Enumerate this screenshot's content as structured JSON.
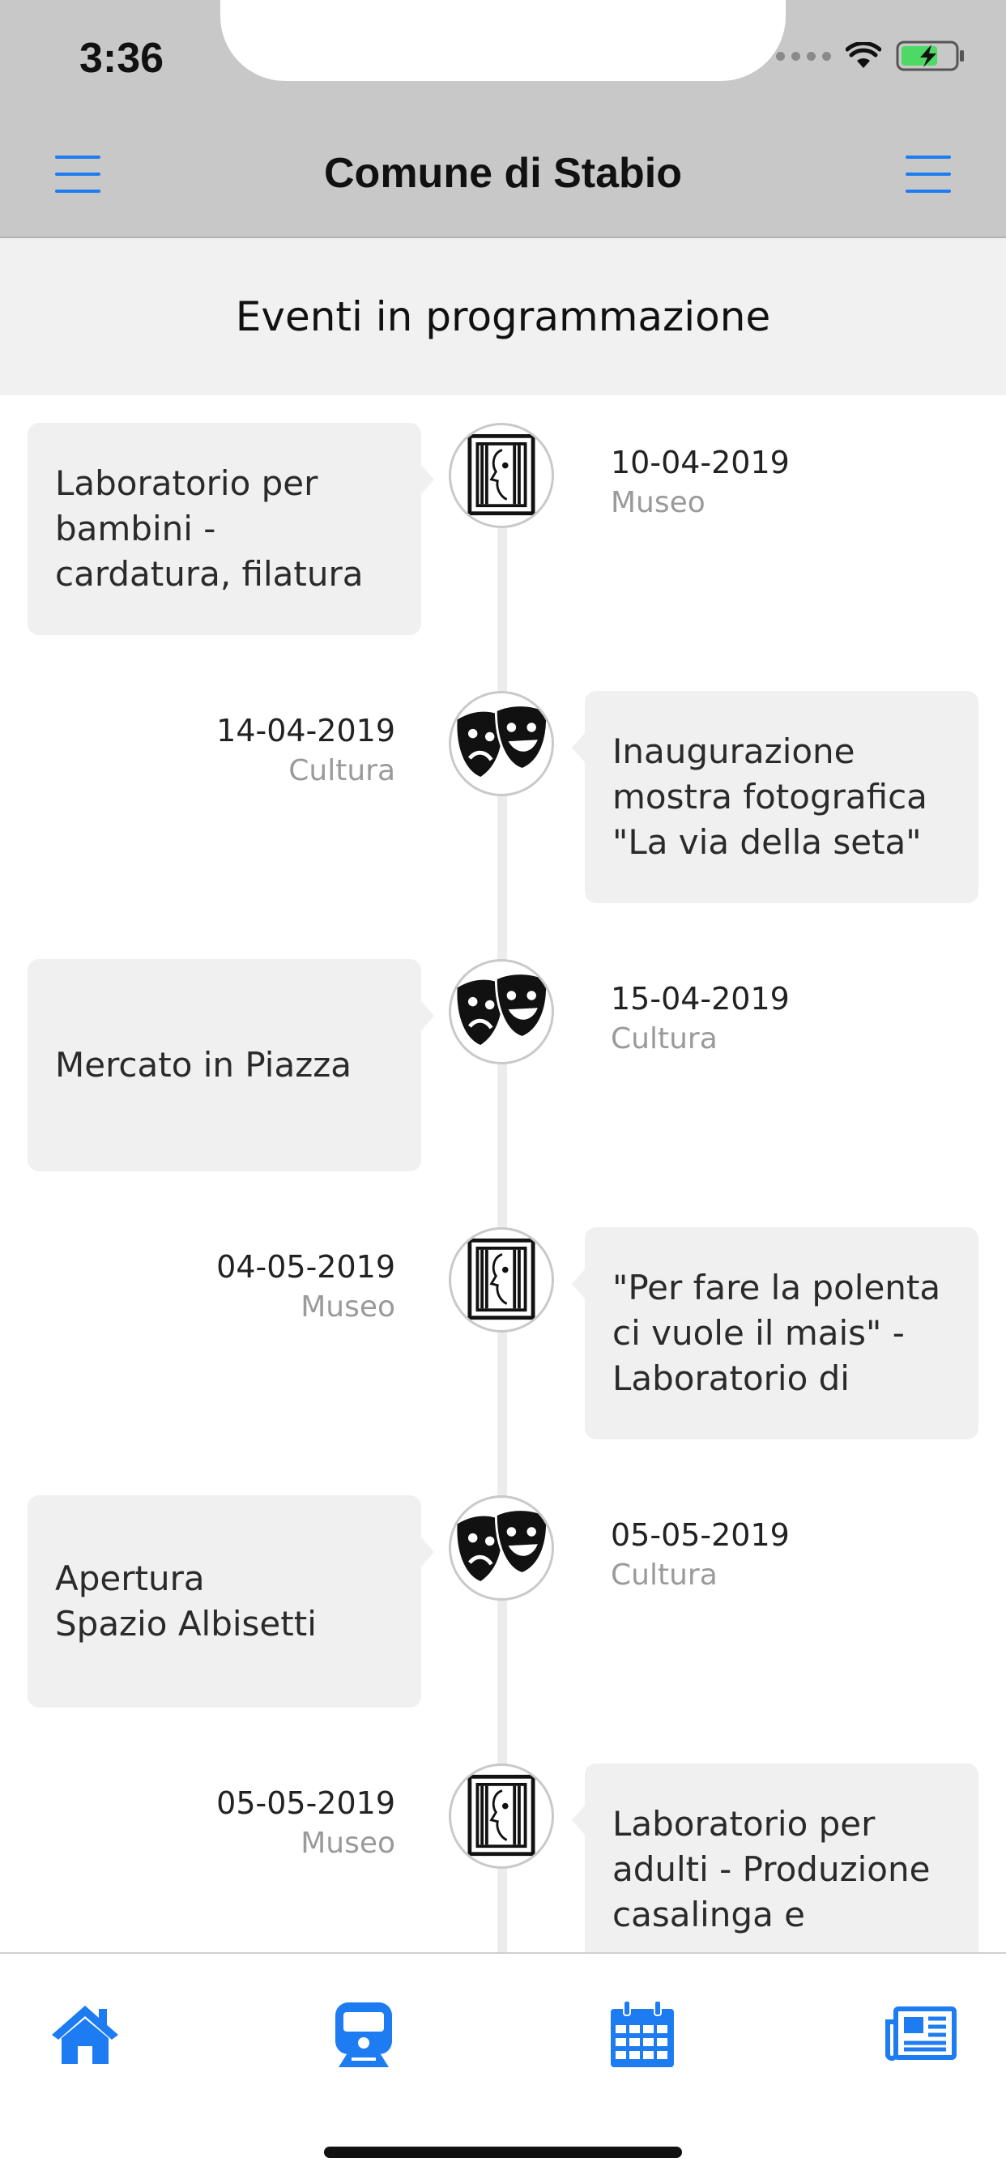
{
  "status_bar": {
    "time": "3:36"
  },
  "nav": {
    "title": "Comune di Stabio",
    "left_icon": "menu-icon",
    "right_icon": "menu-icon"
  },
  "section": {
    "title": "Eventi in programmazione"
  },
  "events": [
    {
      "title": "Laboratorio per bambini - cardatura, filatura e tessitura",
      "date": "10-04-2019",
      "category": "Museo",
      "icon": "museum-icon"
    },
    {
      "title": "Inaugurazione mostra fotografica \"La via della seta\"",
      "date": "14-04-2019",
      "category": "Cultura",
      "icon": "theater-masks-icon"
    },
    {
      "title": "Mercato in Piazza",
      "date": "15-04-2019",
      "category": "Cultura",
      "icon": "theater-masks-icon"
    },
    {
      "title": "\"Per fare la polenta ci vuole il mais\" - Laboratorio di",
      "date": "04-05-2019",
      "category": "Museo",
      "icon": "museum-icon"
    },
    {
      "title": "Apertura\nSpazio Albisetti",
      "date": "05-05-2019",
      "category": "Cultura",
      "icon": "theater-masks-icon"
    },
    {
      "title": "Laboratorio per adulti - Produzione casalinga e artigianale",
      "date": "05-05-2019",
      "category": "Museo",
      "icon": "museum-icon"
    }
  ],
  "tabbar": {
    "tabs": [
      {
        "icon": "home-icon"
      },
      {
        "icon": "train-icon"
      },
      {
        "icon": "calendar-icon"
      },
      {
        "icon": "newspaper-icon"
      }
    ]
  },
  "colors": {
    "accent": "#1e7cf2",
    "header_bg": "#c8c8c8",
    "card_bg": "#f0f0f0",
    "category_text": "#9a9a9a"
  }
}
